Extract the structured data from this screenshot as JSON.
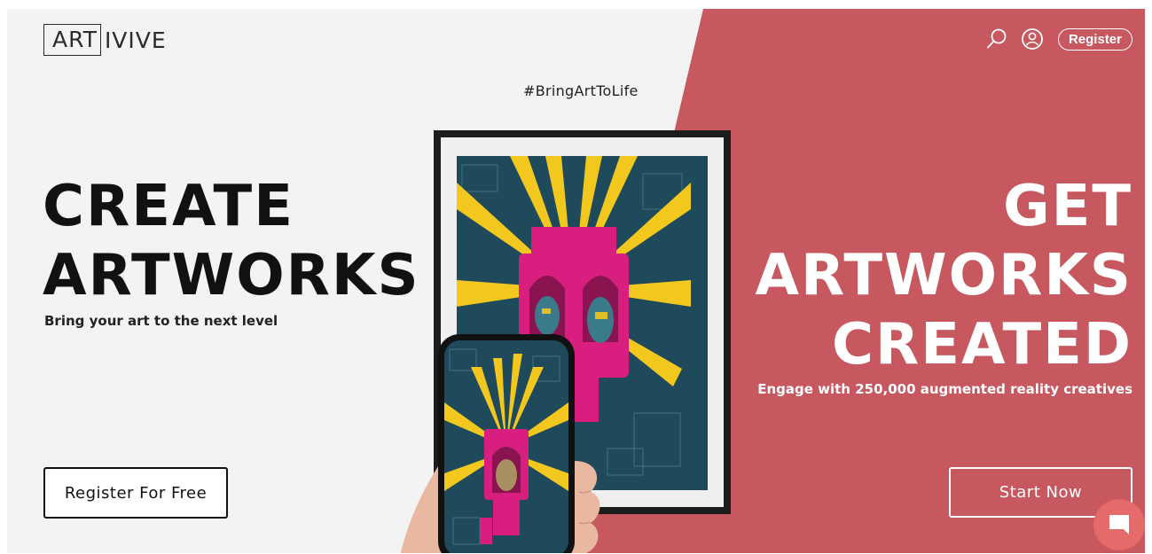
{
  "brand": {
    "logo_boxed": "ART",
    "logo_rest": "IVIVE"
  },
  "nav": {
    "search_icon": "search-icon",
    "account_icon": "user-icon",
    "register_label": "Register"
  },
  "hashtag": "#BringArtToLife",
  "left": {
    "title_line1": "CREATE",
    "title_line2": "ARTWORKS",
    "subtitle": "Bring your art to the next level",
    "button_label": "Register For Free"
  },
  "right": {
    "title_line1": "GET",
    "title_line2": "ARTWORKS",
    "title_line3": "CREATED",
    "subtitle": "Engage with 250,000 augmented reality creatives",
    "button_label": "Start Now"
  },
  "chat": {
    "icon": "chat-icon"
  },
  "colors": {
    "left_bg": "#f3f3f3",
    "right_bg": "#c8585f",
    "chat": "#e56a6a",
    "art_yellow": "#f2c81e",
    "art_magenta": "#d81f7f",
    "art_teal": "#1f4a5c"
  }
}
